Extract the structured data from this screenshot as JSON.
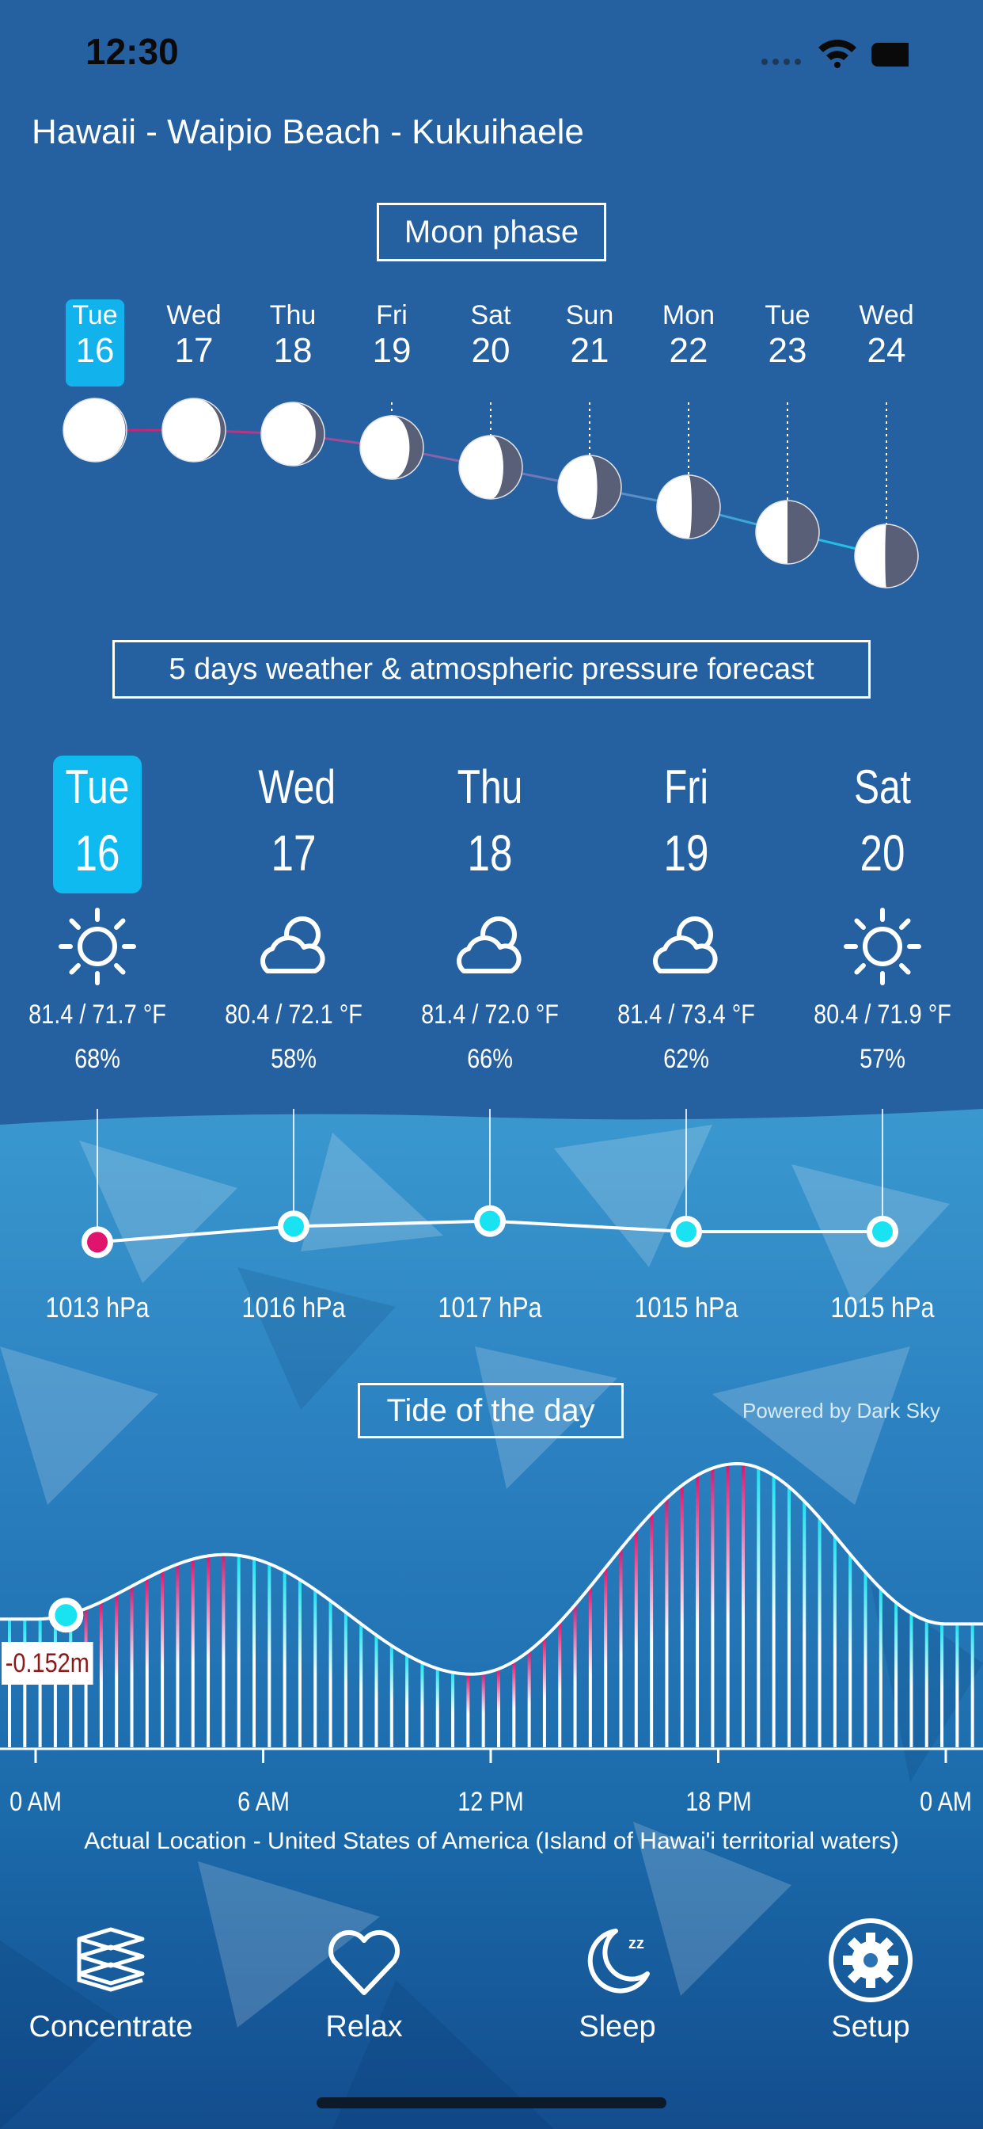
{
  "status_bar": {
    "time": "12:30"
  },
  "location": "Hawaii - Waipio Beach - Kukuihaele",
  "moon": {
    "title": "Moon phase",
    "days": [
      {
        "name": "Tue",
        "date": "16",
        "selected": true
      },
      {
        "name": "Wed",
        "date": "17"
      },
      {
        "name": "Thu",
        "date": "18"
      },
      {
        "name": "Fri",
        "date": "19"
      },
      {
        "name": "Sat",
        "date": "20"
      },
      {
        "name": "Sun",
        "date": "21"
      },
      {
        "name": "Mon",
        "date": "22"
      },
      {
        "name": "Tue",
        "date": "23"
      },
      {
        "name": "Wed",
        "date": "24"
      }
    ],
    "illumination": [
      0.98,
      0.92,
      0.86,
      0.78,
      0.7,
      0.62,
      0.55,
      0.5,
      0.48
    ]
  },
  "forecast": {
    "title": "5 days weather & atmospheric pressure forecast",
    "days": [
      {
        "name": "Tue",
        "date": "16",
        "icon": "sun-icon",
        "temps": "81.4 / 71.7 °F",
        "humidity": "68%",
        "pressure": "1013 hPa",
        "pressure_value": 1013,
        "selected": true
      },
      {
        "name": "Wed",
        "date": "17",
        "icon": "partly-cloudy-icon",
        "temps": "80.4 / 72.1 °F",
        "humidity": "58%",
        "pressure": "1016 hPa",
        "pressure_value": 1016
      },
      {
        "name": "Thu",
        "date": "18",
        "icon": "partly-cloudy-icon",
        "temps": "81.4 / 72.0 °F",
        "humidity": "66%",
        "pressure": "1017 hPa",
        "pressure_value": 1017
      },
      {
        "name": "Fri",
        "date": "19",
        "icon": "partly-cloudy-icon",
        "temps": "81.4 / 73.4 °F",
        "humidity": "62%",
        "pressure": "1015 hPa",
        "pressure_value": 1015
      },
      {
        "name": "Sat",
        "date": "20",
        "icon": "sun-icon",
        "temps": "80.4 / 71.9 °F",
        "humidity": "57%",
        "pressure": "1015 hPa",
        "pressure_value": 1015
      }
    ]
  },
  "tide": {
    "title": "Tide of the day",
    "powered_by": "Powered by Dark Sky",
    "current_label": "-0.152m",
    "current_hour": 0.8,
    "ticks": [
      "0 AM",
      "6 AM",
      "12 PM",
      "18 PM",
      "0 AM"
    ],
    "chart_data": {
      "type": "area",
      "x_hours": [
        0,
        5,
        11.5,
        18.5,
        24
      ],
      "y_relative": [
        0.35,
        0.62,
        0.12,
        1.0,
        0.33
      ]
    },
    "footer": "Actual Location  - United States of America (Island of Hawai'i territorial waters)"
  },
  "colors": {
    "accent": "#12b2ec",
    "bg": "#2560a0",
    "pink": "#e0146c",
    "cyan": "#19e3f0"
  },
  "tabs": [
    {
      "label": "Concentrate",
      "icon": "books-icon"
    },
    {
      "label": "Relax",
      "icon": "heart-icon"
    },
    {
      "label": "Sleep",
      "icon": "moon-sleep-icon"
    },
    {
      "label": "Setup",
      "icon": "gear-icon"
    }
  ]
}
